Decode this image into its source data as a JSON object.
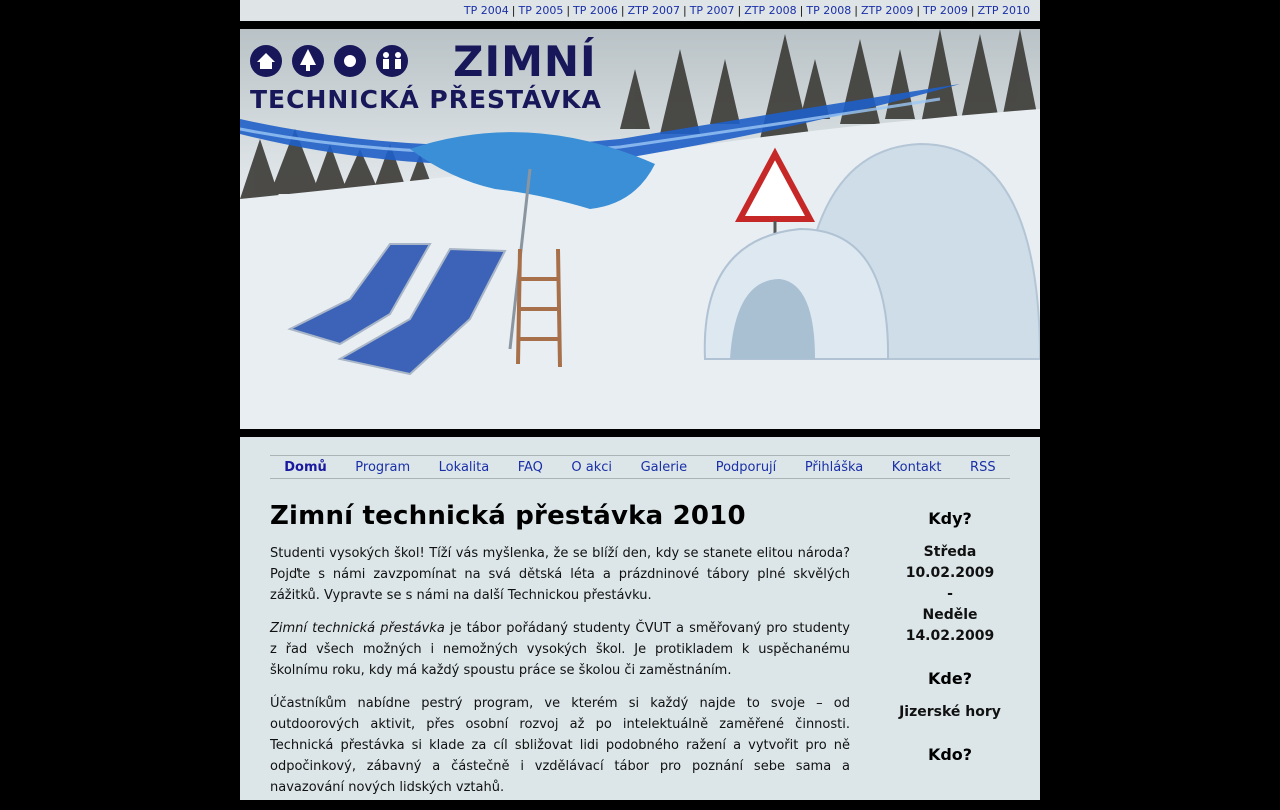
{
  "archive_links": [
    "TP 2004",
    "TP 2005",
    "TP 2006",
    "ZTP 2007",
    "TP 2007",
    "ZTP 2008",
    "TP 2008",
    "ZTP 2009",
    "TP 2009",
    "ZTP 2010"
  ],
  "banner": {
    "logo_line1": "ZIMNÍ",
    "logo_line2": "TECHNICKÁ PŘESTÁVKA",
    "icons": [
      "house-icon",
      "tree-icon",
      "sun-icon",
      "people-icon"
    ]
  },
  "nav": [
    {
      "label": "Domů",
      "active": true
    },
    {
      "label": "Program"
    },
    {
      "label": "Lokalita"
    },
    {
      "label": "FAQ"
    },
    {
      "label": "O akci"
    },
    {
      "label": "Galerie"
    },
    {
      "label": "Podporují"
    },
    {
      "label": "Přihláška"
    },
    {
      "label": "Kontakt"
    },
    {
      "label": "RSS"
    }
  ],
  "main": {
    "title": "Zimní technická přestávka 2010",
    "p1": "Studenti vysokých škol! Tíží vás myšlenka, že se blíží den, kdy se stanete elitou národa? Pojďte s námi zavzpomínat na svá dětská léta a prázdninové tábory plné skvělých zážitků. Vypravte se s námi na další Technickou přestávku.",
    "p2_em": "Zimní technická přestávka",
    "p2_rest": " je tábor pořádaný studenty ČVUT a směřovaný pro studenty z řad všech možných i nemožných vysokých škol. Je protikladem k uspěchanému školnímu roku, kdy má každý spoustu práce se školou či zaměstnáním.",
    "p3": "Účastníkům nabídne pestrý program, ve kterém si každý najde to svoje – od outdoorových aktivit, přes osobní rozvoj až po intelektuálně zaměřené činnosti. Technická přestávka si klade za cíl sbližovat lidi podobného ražení a vytvořit pro ně odpočinkový, zábavný a částečně i vzdělávací tábor pro poznání sebe sama a navazování nových lidských vztahů."
  },
  "side": {
    "when_title": "Kdy?",
    "when_lines": [
      "Středa",
      "10.02.2009",
      "-",
      "Neděle",
      "14.02.2009"
    ],
    "where_title": "Kde?",
    "where_value": "Jizerské hory",
    "who_title": "Kdo?"
  },
  "colors": {
    "link": "#1a2fa8",
    "content_bg": "#dce6e8",
    "topbar_bg": "#dfe5e6",
    "logo": "#17175a"
  }
}
